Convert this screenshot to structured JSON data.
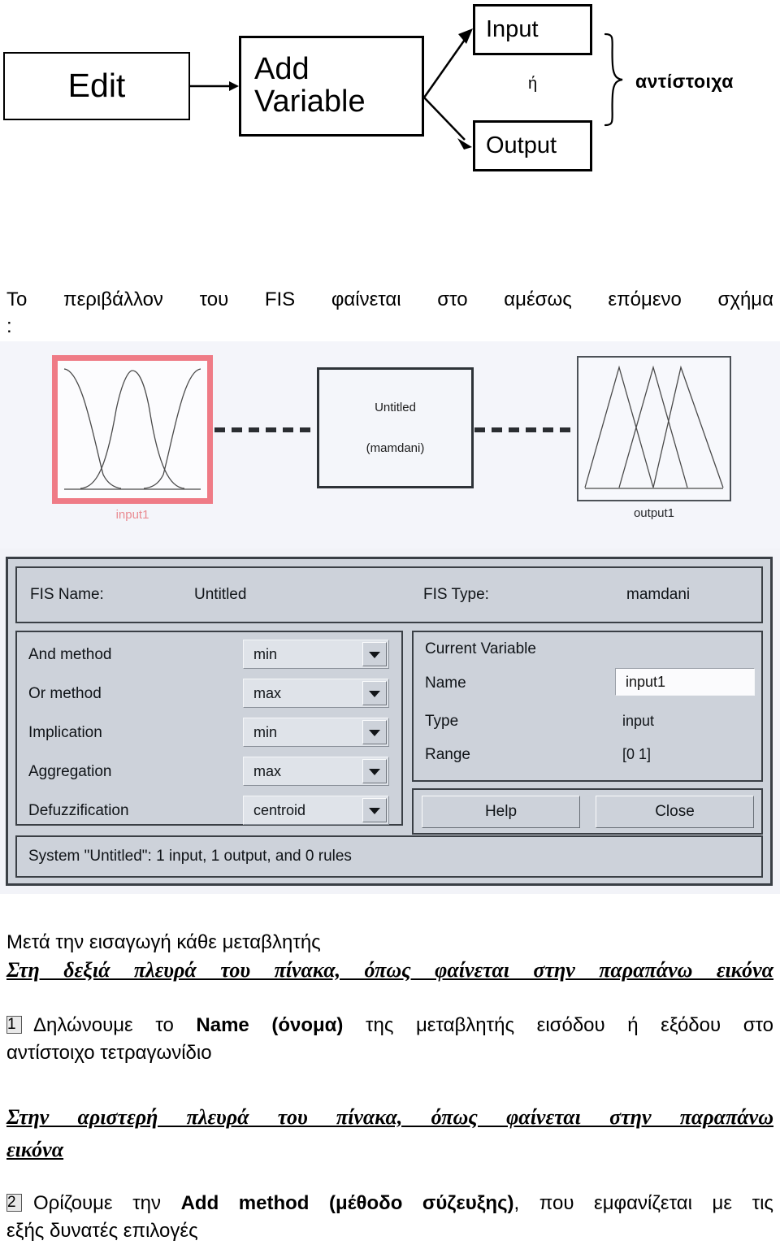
{
  "flow": {
    "boxes": {
      "edit": "Edit",
      "add_variable": "Add\nVariable",
      "input": "Input",
      "output": "Output"
    },
    "or_label": "ή",
    "brace_label": "αντίστοιχα"
  },
  "intro": {
    "line": "Το περιβάλλον του FIS φαίνεται στο αμέσως επόμενο σχήμα",
    "colon": ":"
  },
  "fis_editor": {
    "diagram": {
      "input_caption": "input1",
      "output_caption": "output1",
      "system_name": "Untitled",
      "system_type": "(mamdani)"
    },
    "header": {
      "fis_name_label": "FIS Name:",
      "fis_name_value": "Untitled",
      "fis_type_label": "FIS Type:",
      "fis_type_value": "mamdani"
    },
    "methods": [
      {
        "label": "And method",
        "value": "min"
      },
      {
        "label": "Or method",
        "value": "max"
      },
      {
        "label": "Implication",
        "value": "min"
      },
      {
        "label": "Aggregation",
        "value": "max"
      },
      {
        "label": "Defuzzification",
        "value": "centroid"
      }
    ],
    "current_variable": {
      "title": "Current Variable",
      "name_label": "Name",
      "name_value": "input1",
      "type_label": "Type",
      "type_value": "input",
      "range_label": "Range",
      "range_value": "[0 1]"
    },
    "buttons": {
      "help": "Help",
      "close": "Close"
    },
    "status": "System \"Untitled\": 1 input, 1 output, and 0 rules",
    "colors": {
      "highlight_border": "#ef7b86",
      "panel_background": "#cdd2da",
      "panel_border": "#3a3f45"
    }
  },
  "body_text": {
    "meta_line": "Μετά την εισαγωγή κάθε μεταβλητής",
    "underlined_1": "Στη δεξιά πλευρά του πίνακα, όπως φαίνεται στην παραπάνω εικόνα",
    "item_1": {
      "number": "1",
      "text_before_bold": "Δηλώνουμε το ",
      "bold": "Name (όνομα)",
      "text_after_bold": " της μεταβλητής εισόδου ή εξόδου στο",
      "second_line": "αντίστοιχο τετραγωνίδιο"
    },
    "underlined_2_line1": "Στην αριστερή πλευρά του πίνακα, όπως φαίνεται στην παραπάνω",
    "underlined_2_line2": "εικόνα",
    "item_2": {
      "number": "2",
      "text_before_bold": "Ορίζουμε την ",
      "bold": "Add method (μέθοδο σύζευξης)",
      "text_after_bold": ", που εμφανίζεται με τις",
      "second_line": "εξής δυνατές επιλογές"
    }
  }
}
